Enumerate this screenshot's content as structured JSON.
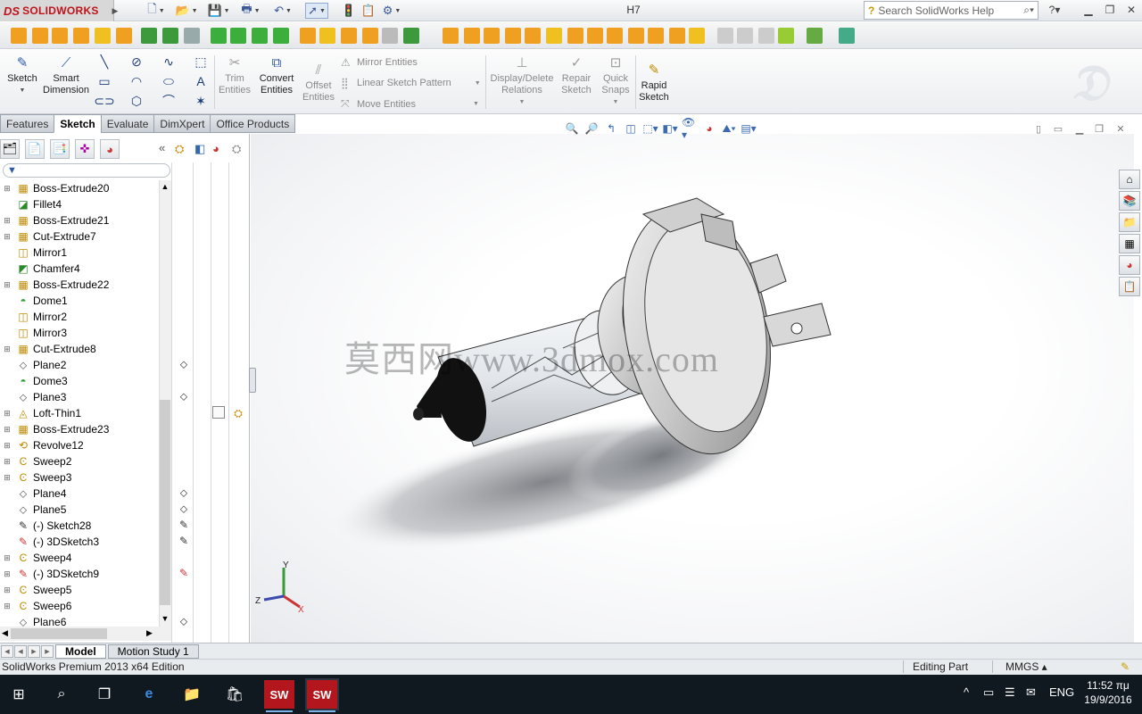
{
  "app": {
    "brand": "SOLIDWORKS",
    "brand_prefix": "DS",
    "document_title": "H7",
    "search_placeholder": "Search SolidWorks Help"
  },
  "command_manager": {
    "sketch": "Sketch",
    "smart_dimension_1": "Smart",
    "smart_dimension_2": "Dimension",
    "trim_1": "Trim",
    "trim_2": "Entities",
    "convert_1": "Convert",
    "convert_2": "Entities",
    "offset_1": "Offset",
    "offset_2": "Entities",
    "mirror_entities": "Mirror Entities",
    "linear_sketch_pattern": "Linear Sketch Pattern",
    "move_entities": "Move Entities",
    "display_delete_1": "Display/Delete",
    "display_delete_2": "Relations",
    "repair_1": "Repair",
    "repair_2": "Sketch",
    "quick_snaps_1": "Quick",
    "quick_snaps_2": "Snaps",
    "rapid_sketch_1": "Rapid",
    "rapid_sketch_2": "Sketch"
  },
  "tabs": [
    "Features",
    "Sketch",
    "Evaluate",
    "DimXpert",
    "Office Products"
  ],
  "active_tab": "Sketch",
  "feature_tree": [
    {
      "label": "Boss-Extrude20",
      "icon": "extrude-icon",
      "expandable": true
    },
    {
      "label": "Fillet4",
      "icon": "fillet-icon",
      "expandable": false
    },
    {
      "label": "Boss-Extrude21",
      "icon": "extrude-icon",
      "expandable": true
    },
    {
      "label": "Cut-Extrude7",
      "icon": "cut-extrude-icon",
      "expandable": true
    },
    {
      "label": "Mirror1",
      "icon": "mirror-icon",
      "expandable": false
    },
    {
      "label": "Chamfer4",
      "icon": "chamfer-icon",
      "expandable": false
    },
    {
      "label": "Boss-Extrude22",
      "icon": "extrude-icon",
      "expandable": true
    },
    {
      "label": "Dome1",
      "icon": "dome-icon",
      "expandable": false
    },
    {
      "label": "Mirror2",
      "icon": "mirror-icon",
      "expandable": false
    },
    {
      "label": "Mirror3",
      "icon": "mirror-icon",
      "expandable": false
    },
    {
      "label": "Cut-Extrude8",
      "icon": "cut-extrude-icon",
      "expandable": true
    },
    {
      "label": "Plane2",
      "icon": "plane-icon",
      "expandable": false
    },
    {
      "label": "Dome3",
      "icon": "dome-icon",
      "expandable": false
    },
    {
      "label": "Plane3",
      "icon": "plane-icon",
      "expandable": false
    },
    {
      "label": "Loft-Thin1",
      "icon": "loft-icon",
      "expandable": true
    },
    {
      "label": "Boss-Extrude23",
      "icon": "extrude-icon",
      "expandable": true
    },
    {
      "label": "Revolve12",
      "icon": "revolve-icon",
      "expandable": true
    },
    {
      "label": "Sweep2",
      "icon": "sweep-icon",
      "expandable": true
    },
    {
      "label": "Sweep3",
      "icon": "sweep-icon",
      "expandable": true
    },
    {
      "label": "Plane4",
      "icon": "plane-icon",
      "expandable": false
    },
    {
      "label": "Plane5",
      "icon": "plane-icon",
      "expandable": false
    },
    {
      "label": "(-) Sketch28",
      "icon": "sketch-icon",
      "expandable": false
    },
    {
      "label": "(-) 3DSketch3",
      "icon": "3dsketch-icon",
      "expandable": false
    },
    {
      "label": "Sweep4",
      "icon": "sweep-icon",
      "expandable": true
    },
    {
      "label": "(-) 3DSketch9",
      "icon": "3dsketch-icon",
      "expandable": true
    },
    {
      "label": "Sweep5",
      "icon": "sweep-icon",
      "expandable": true
    },
    {
      "label": "Sweep6",
      "icon": "sweep-icon",
      "expandable": true
    },
    {
      "label": "Plane6",
      "icon": "plane-icon",
      "expandable": false
    }
  ],
  "watermark": "莫西网www.3dmox.com",
  "triad": {
    "x": "X",
    "y": "Y",
    "z": "Z"
  },
  "bottom_tabs": [
    "Model",
    "Motion Study 1"
  ],
  "status": {
    "edition": "SolidWorks Premium 2013 x64 Edition",
    "mode": "Editing Part",
    "units": "MMGS"
  },
  "taskbar": {
    "language": "ENG",
    "time": "11:52 πμ",
    "date": "19/9/2016"
  },
  "colors": {
    "brand_red": "#c0121a",
    "taskbar_bg": "#101820",
    "active_tab": "#ffffff"
  }
}
